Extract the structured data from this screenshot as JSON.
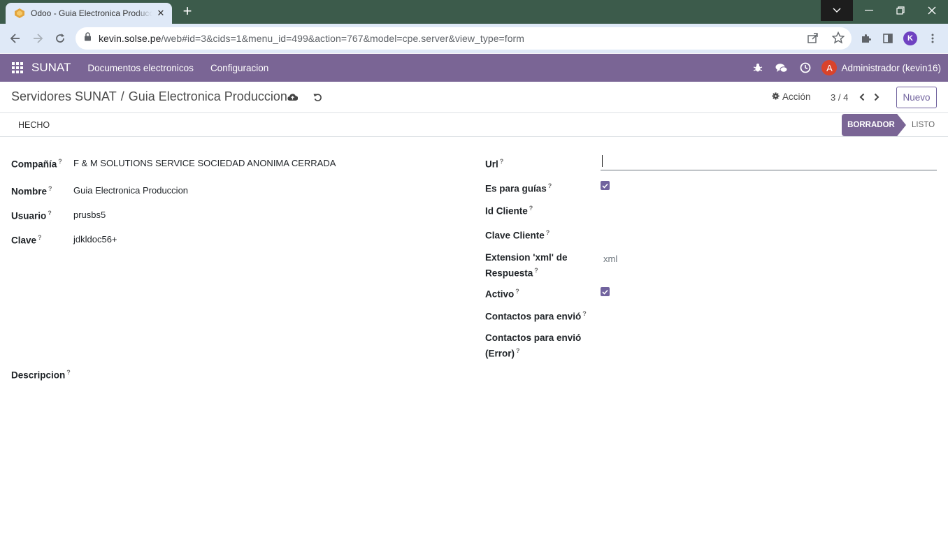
{
  "browser": {
    "tab_title": "Odoo - Guia Electronica Producción",
    "url_host": "kevin.solse.pe",
    "url_path": "/web#id=3&cids=1&menu_id=499&action=767&model=cpe.server&view_type=form",
    "profile_initial": "K"
  },
  "navbar": {
    "brand": "SUNAT",
    "menu": [
      "Documentos electronicos",
      "Configuracion"
    ],
    "user_initial": "A",
    "user_name": "Administrador (kevin16)"
  },
  "control_panel": {
    "breadcrumb_parent": "Servidores SUNAT",
    "breadcrumb_sep": "/",
    "breadcrumb_current": "Guia Electronica Produccion",
    "action_label": "Acción",
    "pager": "3 / 4",
    "new_button": "Nuevo"
  },
  "statusbar": {
    "button": "HECHO",
    "stages": [
      {
        "label": "BORRADOR",
        "active": true
      },
      {
        "label": "LISTO",
        "active": false
      }
    ]
  },
  "form": {
    "left": [
      {
        "label": "Compañía",
        "value": "F & M SOLUTIONS SERVICE SOCIEDAD ANONIMA CERRADA"
      },
      {
        "label": "Nombre",
        "value": "Guia Electronica Produccion"
      },
      {
        "label": "Usuario",
        "value": "prusbs5"
      },
      {
        "label": "Clave",
        "value": "jdkldoc56+"
      }
    ],
    "description_label": "Descripcion",
    "right": {
      "url_label": "Url",
      "url_value": "",
      "es_para_guias_label": "Es para guías",
      "es_para_guias": true,
      "id_cliente_label": "Id Cliente",
      "clave_cliente_label": "Clave Cliente",
      "ext_label_line1": "Extension 'xml' de",
      "ext_label_line2": "Respuesta",
      "ext_value": "xml",
      "activo_label": "Activo",
      "activo": true,
      "contactos_label": "Contactos para envió",
      "contactos_error_line1": "Contactos para envió",
      "contactos_error_line2": "(Error)"
    },
    "help_mark": "?"
  },
  "colors": {
    "navbar": "#7a6595",
    "primary": "#71639e",
    "tabstrip": "#3c5b4b",
    "chrome_toolbar": "#dfe9f7"
  }
}
